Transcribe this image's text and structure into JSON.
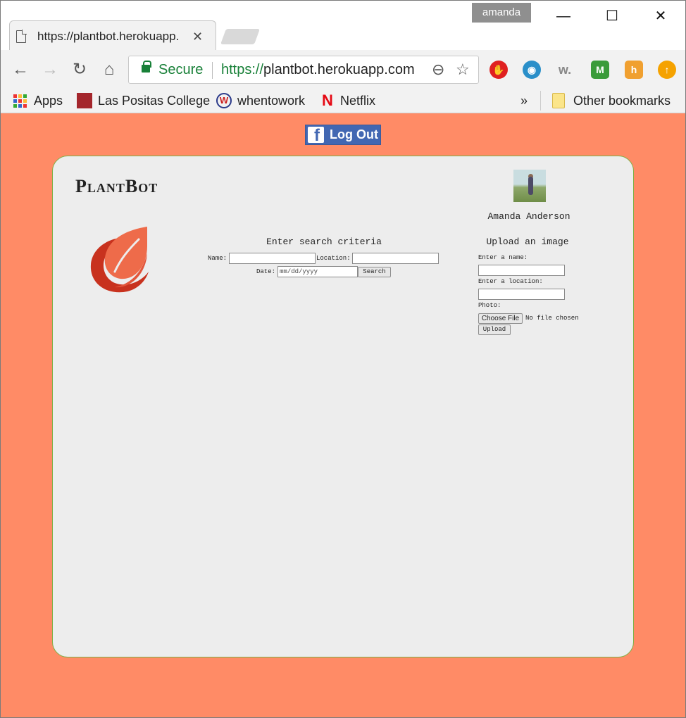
{
  "browser": {
    "profile_name": "amanda",
    "tab_title": "https://plantbot.herokuapp.com",
    "address": {
      "security_label": "Secure",
      "url_scheme": "https://",
      "url_rest": "plantbot.herokuapp.com"
    },
    "bookmarks": [
      "Apps",
      "Las Positas College",
      "whentowork",
      "Netflix"
    ],
    "bookmarks_overflow": "»",
    "other_bookmarks": "Other bookmarks"
  },
  "page": {
    "logout_label": "Log Out",
    "brand": "PlantBot",
    "user_name": "Amanda Anderson",
    "search": {
      "title": "Enter search criteria",
      "name_label": "Name:",
      "location_label": "Location:",
      "date_label": "Date:",
      "date_placeholder": "mm/dd/yyyy",
      "button": "Search"
    },
    "upload": {
      "title": "Upload an image",
      "name_label": "Enter a name:",
      "location_label": "Enter a location:",
      "photo_label": "Photo:",
      "choose_file": "Choose File",
      "no_file": "No file chosen",
      "button": "Upload"
    }
  },
  "colors": {
    "page_background": "#ff8b66",
    "card_background": "#ededed",
    "card_border": "#7db043",
    "facebook_blue": "#4267b2",
    "secure_green": "#188038"
  }
}
